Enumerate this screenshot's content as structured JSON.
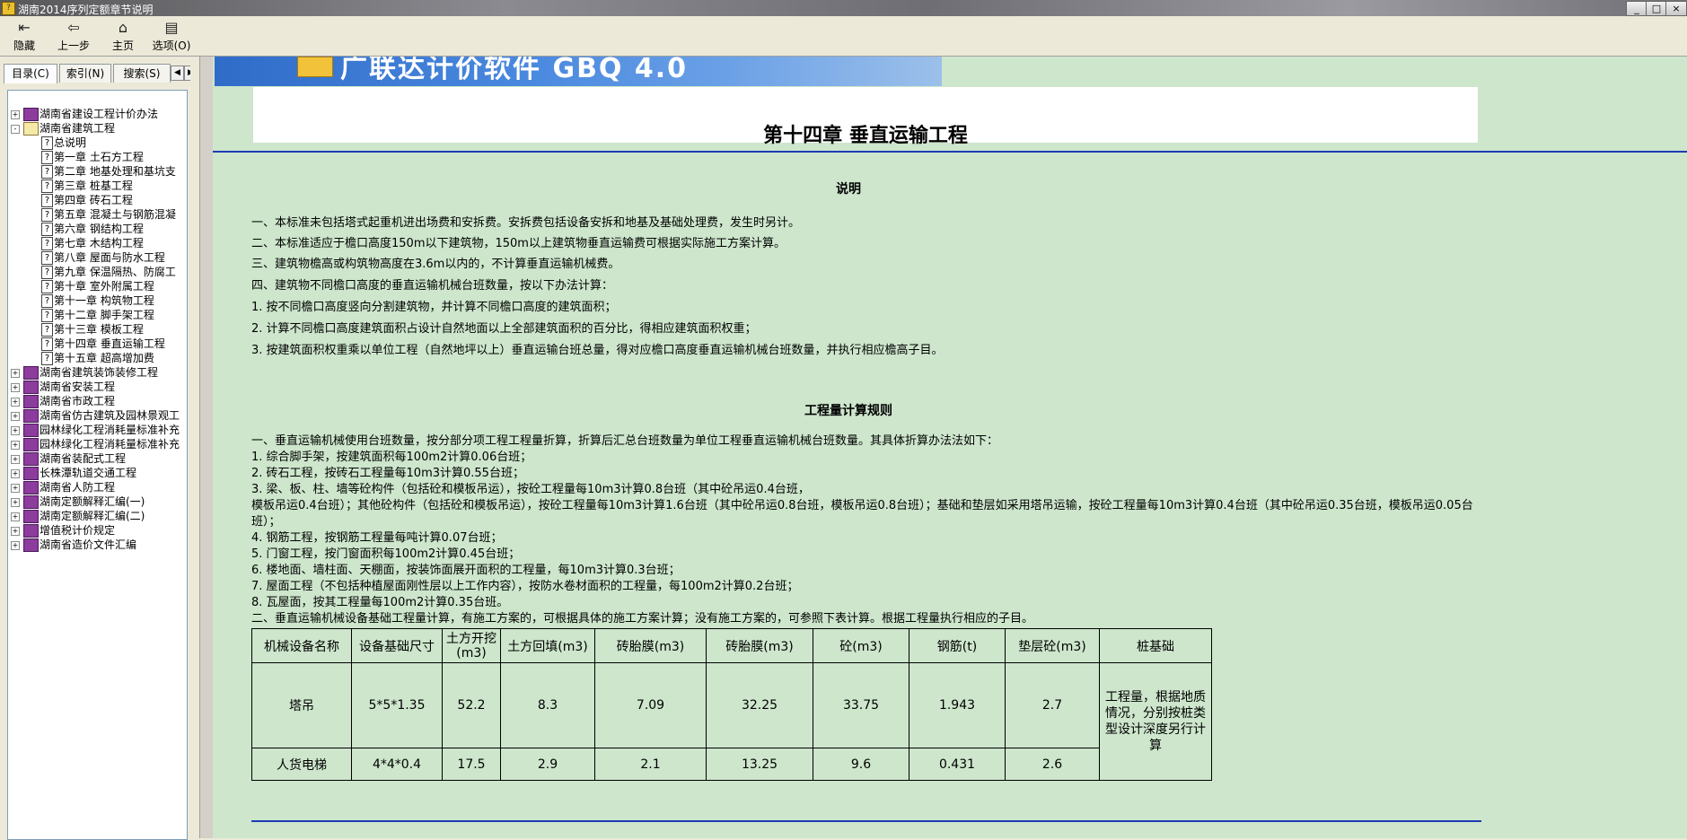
{
  "window": {
    "title": "湖南2014序列定额章节说明"
  },
  "toolbar": {
    "hide": "隐藏",
    "back": "上一步",
    "home": "主页",
    "options": "选项(O)"
  },
  "tabs": {
    "contents": "目录(C)",
    "index": "索引(N)",
    "search": "搜索(S)"
  },
  "tree": [
    {
      "label": "湖南省建设工程计价办法",
      "type": "book",
      "expand": "+"
    },
    {
      "label": "湖南省建筑工程",
      "type": "book-open",
      "expand": "-"
    },
    {
      "label": "总说明",
      "type": "topic"
    },
    {
      "label": "第一章  土石方工程",
      "type": "topic"
    },
    {
      "label": "第二章  地基处理和基坑支",
      "type": "topic"
    },
    {
      "label": "第三章  桩基工程",
      "type": "topic"
    },
    {
      "label": "第四章  砖石工程",
      "type": "topic"
    },
    {
      "label": "第五章  混凝土与钢筋混凝",
      "type": "topic"
    },
    {
      "label": "第六章  钢结构工程",
      "type": "topic"
    },
    {
      "label": "第七章  木结构工程",
      "type": "topic"
    },
    {
      "label": "第八章  屋面与防水工程",
      "type": "topic"
    },
    {
      "label": "第九章  保温隔热、防腐工",
      "type": "topic"
    },
    {
      "label": "第十章  室外附属工程",
      "type": "topic"
    },
    {
      "label": "第十一章  构筑物工程",
      "type": "topic"
    },
    {
      "label": "第十二章  脚手架工程",
      "type": "topic"
    },
    {
      "label": "第十三章  模板工程",
      "type": "topic"
    },
    {
      "label": "第十四章  垂直运输工程",
      "type": "topic"
    },
    {
      "label": "第十五章  超高增加费",
      "type": "topic"
    },
    {
      "label": "湖南省建筑装饰装修工程",
      "type": "book",
      "expand": "+"
    },
    {
      "label": "湖南省安装工程",
      "type": "book",
      "expand": "+"
    },
    {
      "label": "湖南省市政工程",
      "type": "book",
      "expand": "+"
    },
    {
      "label": "湖南省仿古建筑及园林景观工",
      "type": "book",
      "expand": "+"
    },
    {
      "label": "园林绿化工程消耗量标准补充",
      "type": "book",
      "expand": "+"
    },
    {
      "label": "园林绿化工程消耗量标准补充",
      "type": "book",
      "expand": "+"
    },
    {
      "label": "湖南省装配式工程",
      "type": "book",
      "expand": "+"
    },
    {
      "label": "长株潭轨道交通工程",
      "type": "book",
      "expand": "+"
    },
    {
      "label": "湖南省人防工程",
      "type": "book",
      "expand": "+"
    },
    {
      "label": "湖南定额解释汇编(一)",
      "type": "book",
      "expand": "+"
    },
    {
      "label": "湖南定额解释汇编(二)",
      "type": "book",
      "expand": "+"
    },
    {
      "label": "增值税计价规定",
      "type": "book",
      "expand": "+"
    },
    {
      "label": "湖南省造价文件汇编",
      "type": "book",
      "expand": "+"
    }
  ],
  "banner": {
    "text": "广联达计价软件 GBQ 4.0"
  },
  "content": {
    "chapter_title": "第十四章  垂直运输工程",
    "section1_title": "说明",
    "explain": [
      "一、本标准未包括塔式起重机进出场费和安拆费。安拆费包括设备安拆和地基及基础处理费，发生时另计。",
      "二、本标准适应于檐口高度150m以下建筑物，150m以上建筑物垂直运输费可根据实际施工方案计算。",
      "三、建筑物檐高或构筑物高度在3.6m以内的，不计算垂直运输机械费。",
      "四、建筑物不同檐口高度的垂直运输机械台班数量，按以下办法计算：",
      "1. 按不同檐口高度竖向分割建筑物，并计算不同檐口高度的建筑面积；",
      "2. 计算不同檐口高度建筑面积占设计自然地面以上全部建筑面积的百分比，得相应建筑面积权重；",
      "3. 按建筑面积权重乘以单位工程（自然地坪以上）垂直运输台班总量，得对应檐口高度垂直运输机械台班数量，并执行相应檐高子目。"
    ],
    "section2_title": "工程量计算规则",
    "rules": [
      "一、垂直运输机械使用台班数量，按分部分项工程工程量折算，折算后汇总台班数量为单位工程垂直运输机械台班数量。其具体折算办法法如下：",
      "1. 综合脚手架，按建筑面积每100m2计算0.06台班；",
      "2. 砖石工程，按砖石工程量每10m3计算0.55台班；",
      "3. 梁、板、柱、墙等砼构件（包括砼和模板吊运），按砼工程量每10m3计算0.8台班（其中砼吊运0.4台班，",
      "模板吊运0.4台班）；其他砼构件（包括砼和模板吊运），按砼工程量每10m3计算1.6台班（其中砼吊运0.8台班，模板吊运0.8台班）；基础和垫层如采用塔吊运输，按砼工程量每10m3计算0.4台班（其中砼吊运0.35台班，模板吊运0.05台班）；",
      "4. 钢筋工程，按钢筋工程量每吨计算0.07台班；",
      "5. 门窗工程，按门窗面积每100m2计算0.45台班；",
      "6. 楼地面、墙柱面、天棚面，按装饰面展开面积的工程量，每10m3计算0.3台班；",
      "7. 屋面工程（不包括种植屋面刚性层以上工作内容），按防水卷材面积的工程量，每100m2计算0.2台班；",
      "8. 瓦屋面，按其工程量每100m2计算0.35台班。",
      "二、垂直运输机械设备基础工程量计算，有施工方案的，可根据具体的施工方案计算；没有施工方案的，可参照下表计算。根据工程量执行相应的子目。"
    ],
    "table": {
      "headers": [
        "机械设备名称",
        "设备基础尺寸",
        "土方开挖(m3)",
        "土方回填(m3)",
        "砖胎膜(m3)",
        "砖胎膜(m3)",
        "砼(m3)",
        "钢筋(t)",
        "垫层砼(m3)",
        "桩基础"
      ],
      "rows": [
        [
          "塔吊",
          "5*5*1.35",
          "52.2",
          "8.3",
          "7.09",
          "32.25",
          "33.75",
          "1.943",
          "2.7"
        ],
        [
          "人货电梯",
          "4*4*0.4",
          "17.5",
          "2.9",
          "2.1",
          "13.25",
          "9.6",
          "0.431",
          "2.6"
        ]
      ],
      "pile_note": "工程量，根据地质情况，分别按桩类型设计深度另行计算"
    }
  }
}
